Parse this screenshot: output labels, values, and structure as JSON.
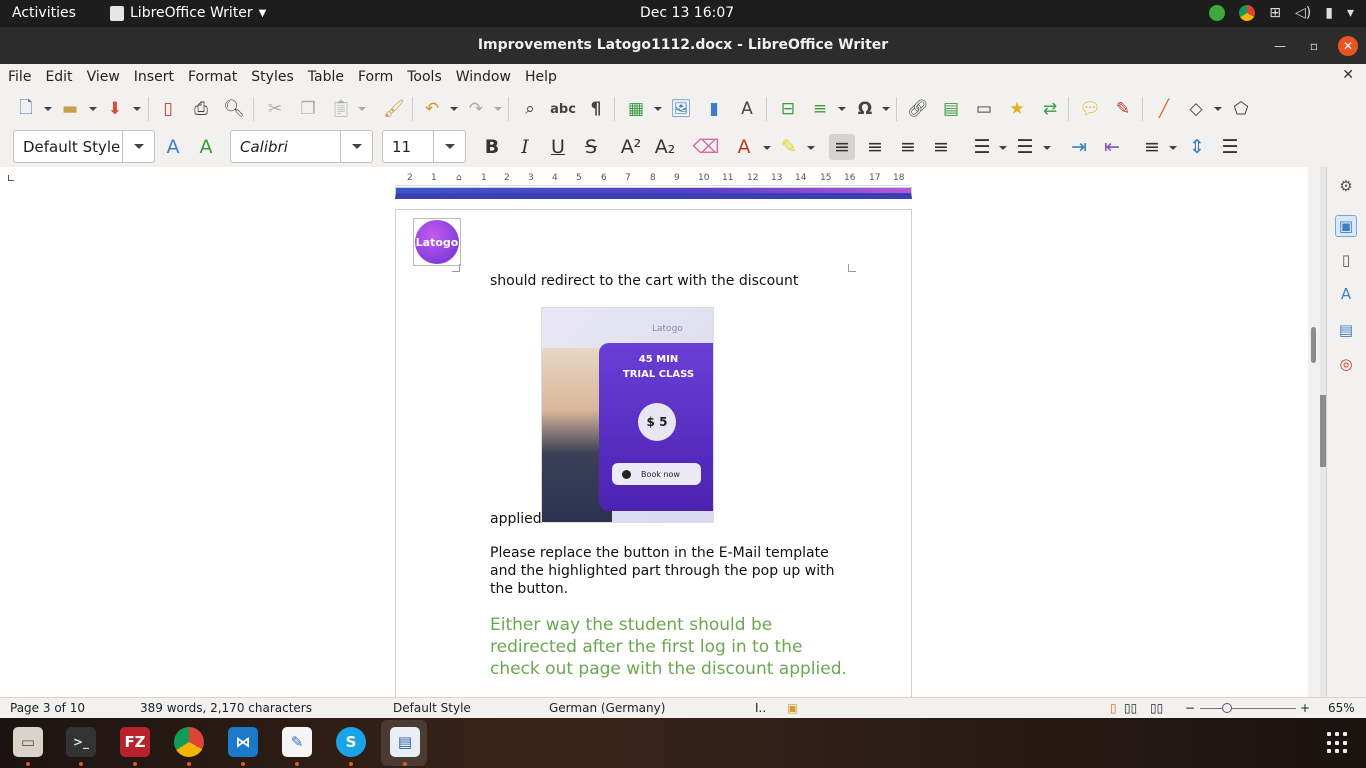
{
  "topbar": {
    "activities": "Activities",
    "app_name": "LibreOffice Writer",
    "clock": "Dec 13  16:07"
  },
  "window": {
    "title": "Improvements Latogo1112.docx - LibreOffice Writer"
  },
  "menu": [
    "File",
    "Edit",
    "View",
    "Insert",
    "Format",
    "Styles",
    "Table",
    "Form",
    "Tools",
    "Window",
    "Help"
  ],
  "formatting": {
    "paragraph_style": "Default Style",
    "font_name": "Calibri",
    "font_size": "11"
  },
  "ruler": [
    "2",
    "1",
    "1",
    "2",
    "3",
    "4",
    "5",
    "6",
    "7",
    "8",
    "9",
    "10",
    "11",
    "12",
    "13",
    "14",
    "15",
    "16",
    "17",
    "18"
  ],
  "document": {
    "logo_text": "Latogo",
    "line_redirect": "should redirect to the cart with the discount",
    "line_applied": "applied",
    "promo": {
      "brand": "Latogo",
      "line1": "45 MIN",
      "line2": "TRIAL CLASS",
      "price": "$ 5",
      "button": "Book now"
    },
    "para_replace": "Please replace the button in the E-Mail template and the highlighted part through the pop up with the button.",
    "para_green": "Either way the student should be redirected after the first log in to the check out page with the discount applied."
  },
  "status": {
    "page": "Page 3 of 10",
    "words": "389 words, 2,170 characters",
    "style": "Default Style",
    "language": "German (Germany)",
    "zoom": "65%"
  },
  "colors": {
    "accent_orange": "#e95420",
    "green_text": "#6aa84f",
    "promo_purple": "#5a2fc6"
  }
}
